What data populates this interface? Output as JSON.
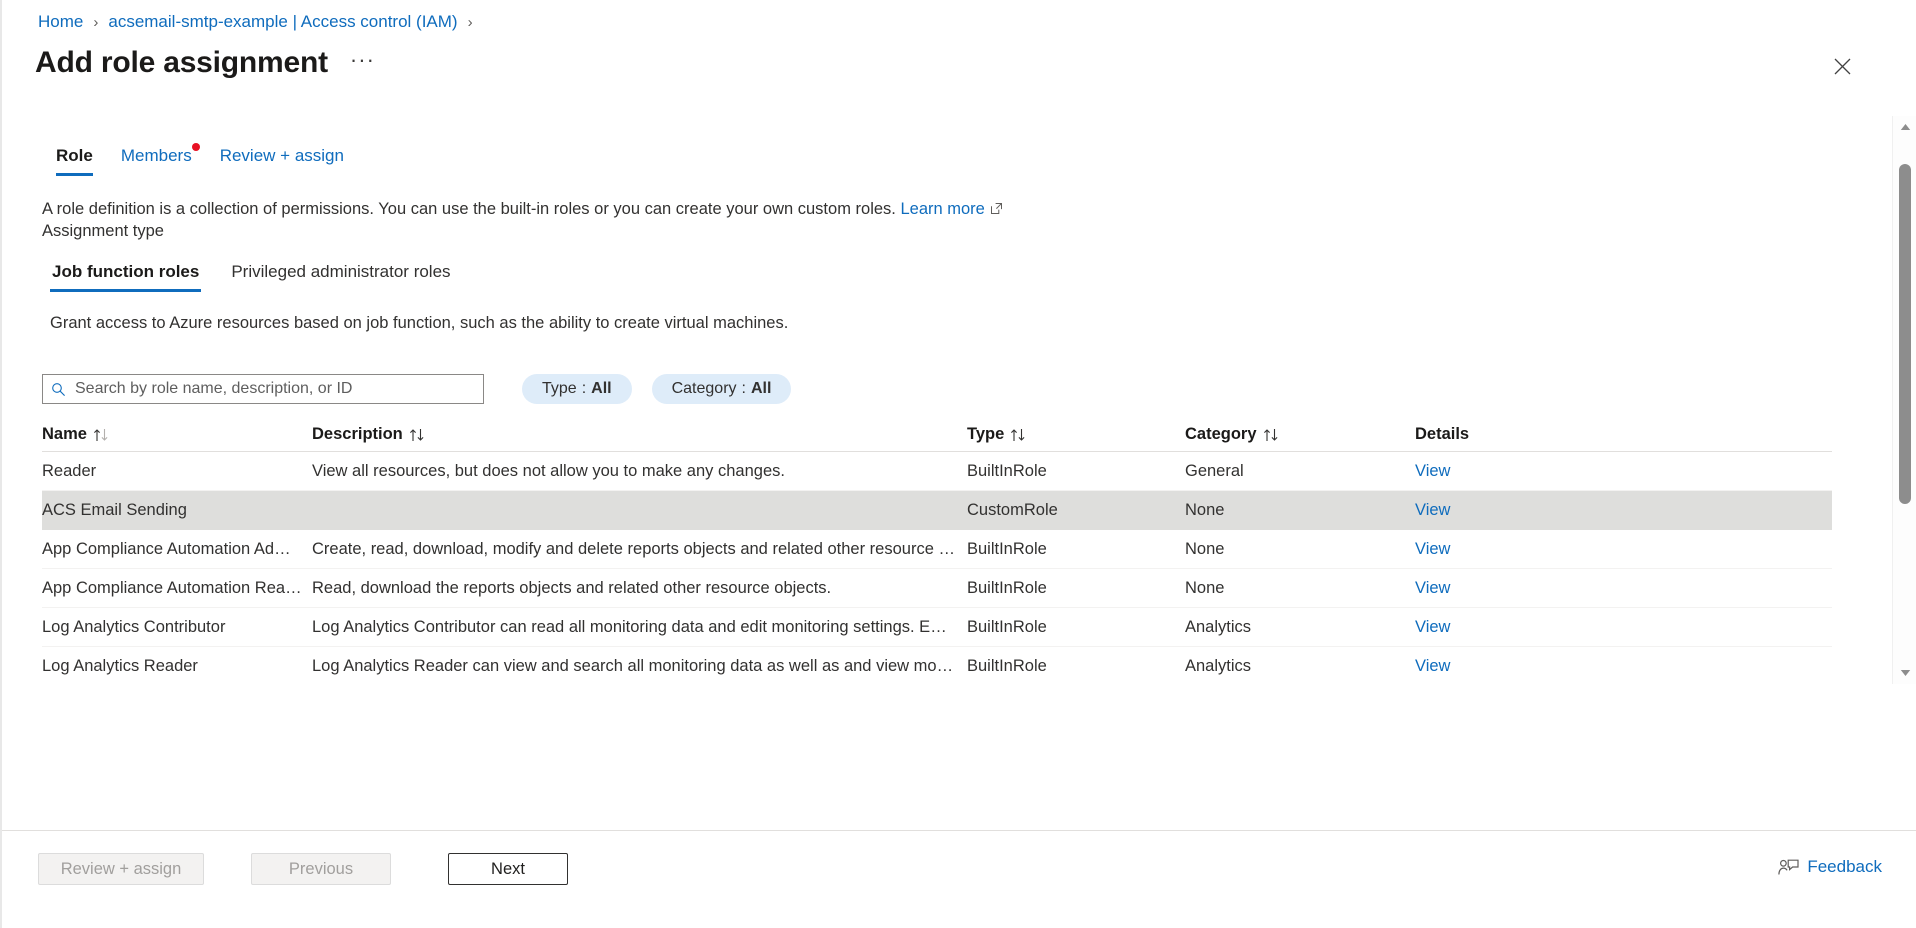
{
  "breadcrumb": {
    "items": [
      {
        "label": "Home"
      },
      {
        "label": "acsemail-smtp-example | Access control (IAM)"
      }
    ],
    "separator": "›"
  },
  "header": {
    "title": "Add role assignment",
    "more_label": "···",
    "close_label": "✕"
  },
  "tabs": [
    {
      "label": "Role",
      "active": true,
      "badge": false
    },
    {
      "label": "Members",
      "active": false,
      "badge": true
    },
    {
      "label": "Review + assign",
      "active": false,
      "badge": false
    }
  ],
  "description": {
    "text": "A role definition is a collection of permissions. You can use the built-in roles or you can create your own custom roles.",
    "link_label": "Learn more",
    "assignment_type_label": "Assignment type"
  },
  "subtabs": [
    {
      "label": "Job function roles",
      "active": true
    },
    {
      "label": "Privileged administrator roles",
      "active": false
    }
  ],
  "grant_text": "Grant access to Azure resources based on job function, such as the ability to create virtual machines.",
  "search": {
    "placeholder": "Search by role name, description, or ID",
    "value": "",
    "icon": "search-icon"
  },
  "filters": [
    {
      "name": "Type",
      "separator": ":",
      "value": "All"
    },
    {
      "name": "Category",
      "separator": ":",
      "value": "All"
    }
  ],
  "table": {
    "columns": [
      {
        "label": "Name",
        "sortable": true
      },
      {
        "label": "Description",
        "sortable": true
      },
      {
        "label": "Type",
        "sortable": true
      },
      {
        "label": "Category",
        "sortable": true
      },
      {
        "label": "Details",
        "sortable": false
      }
    ],
    "details_link_label": "View",
    "rows": [
      {
        "name": "Reader",
        "description": "View all resources, but does not allow you to make any changes.",
        "type": "BuiltInRole",
        "category": "General",
        "details": "View",
        "selected": false
      },
      {
        "name": "ACS Email Sending",
        "description": "",
        "type": "CustomRole",
        "category": "None",
        "details": "View",
        "selected": true
      },
      {
        "name": "App Compliance Automation Admi...",
        "description": "Create, read, download, modify and delete reports objects and related other resource obj...",
        "type": "BuiltInRole",
        "category": "None",
        "details": "View",
        "selected": false
      },
      {
        "name": "App Compliance Automation Reader",
        "description": "Read, download the reports objects and related other resource objects.",
        "type": "BuiltInRole",
        "category": "None",
        "details": "View",
        "selected": false
      },
      {
        "name": "Log Analytics Contributor",
        "description": "Log Analytics Contributor can read all monitoring data and edit monitoring settings. Editi...",
        "type": "BuiltInRole",
        "category": "Analytics",
        "details": "View",
        "selected": false
      },
      {
        "name": "Log Analytics Reader",
        "description": "Log Analytics Reader can view and search all monitoring data as well as and view monitori...",
        "type": "BuiltInRole",
        "category": "Analytics",
        "details": "View",
        "selected": false
      }
    ]
  },
  "footer": {
    "review_assign_label": "Review + assign",
    "previous_label": "Previous",
    "next_label": "Next",
    "feedback_label": "Feedback"
  },
  "colors": {
    "accent": "#0f6cbd",
    "badge": "#e81123",
    "selected_row": "#dededc",
    "pill_bg": "#deecf9"
  }
}
